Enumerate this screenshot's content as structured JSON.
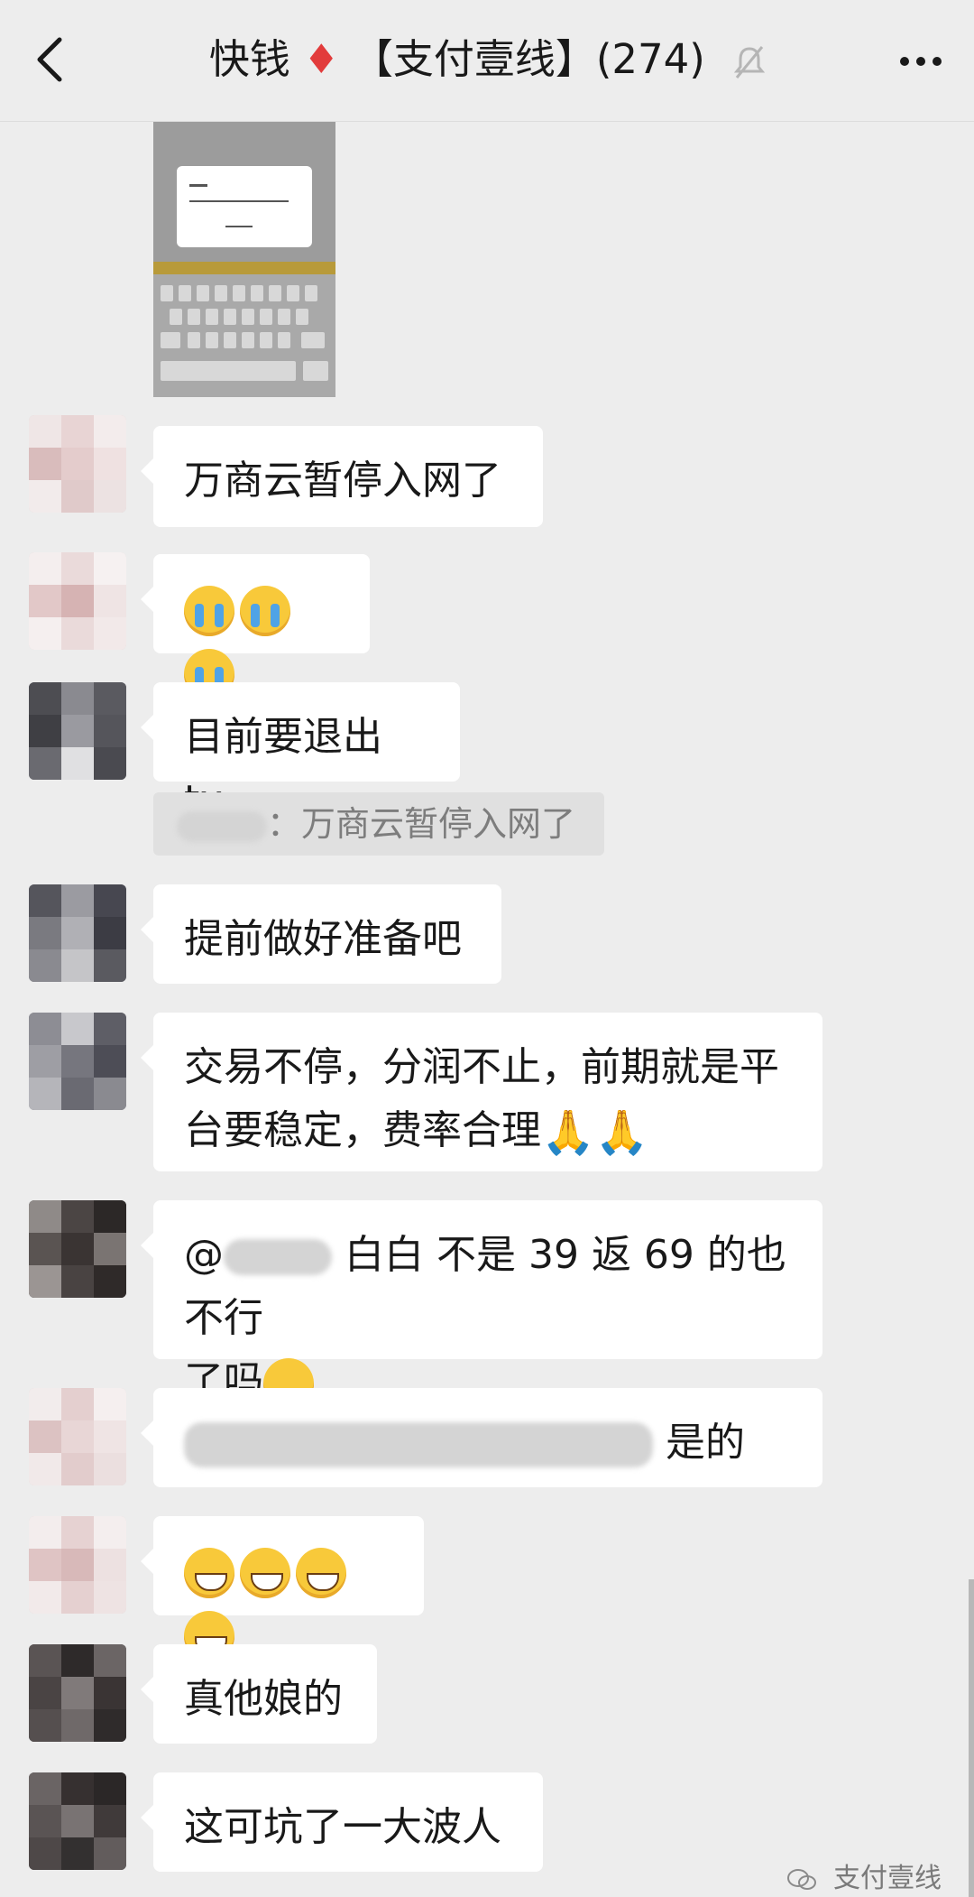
{
  "header": {
    "title_prefix": "快钱",
    "diamond": "♦",
    "title_suffix": "【支付壹线】(274)",
    "icons": [
      "back-arrow-icon",
      "mute-bell-icon",
      "more-dots-icon"
    ]
  },
  "messages": [
    {
      "text": "万商云暂停入网了"
    },
    {
      "emojis": [
        "cry",
        "cry",
        "cry"
      ]
    },
    {
      "text": "目前要退出 tx"
    },
    {
      "quote_text": "：万商云暂停入网了"
    },
    {
      "text": "提前做好准备吧"
    },
    {
      "line1": "交易不停，分润不止，前期就是平",
      "line2": "台要稳定，费率合理"
    },
    {
      "line1_prefix": "@",
      "line1_visible": "白白 不是 39 返 69 的也不行",
      "line2": "了吗"
    },
    {
      "visible_tail": "是的"
    },
    {
      "emojis": [
        "grin",
        "grin",
        "grin",
        "grin"
      ]
    },
    {
      "text": "真他娘的"
    },
    {
      "text": "这可坑了一大波人"
    }
  ],
  "watermark": {
    "label": "支付壹线"
  },
  "colors": {
    "background": "#ededed",
    "bubble": "#ffffff",
    "diamond": "#e23b3b"
  }
}
